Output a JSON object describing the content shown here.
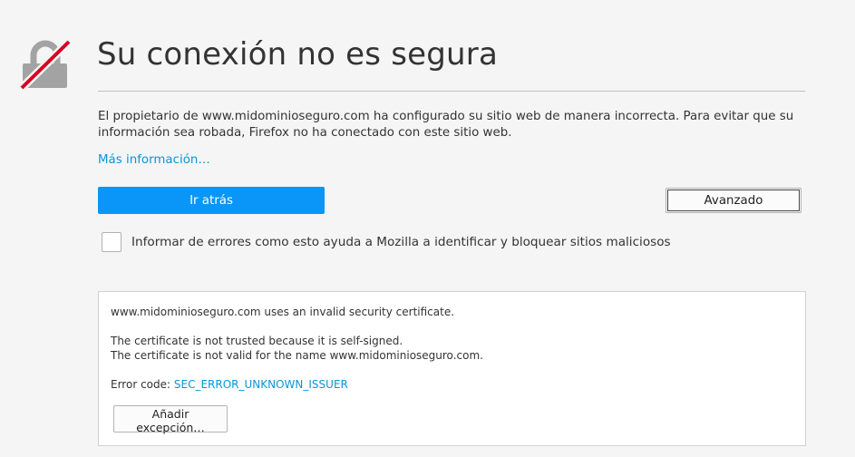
{
  "page": {
    "title": "Su conexión no es segura",
    "description": "El propietario de www.midominioseguro.com ha configurado su sitio web de manera incorrecta. Para evitar que su información sea robada, Firefox no ha conectado con este sitio web.",
    "more_info_link": "Más información…",
    "back_button": "Ir atrás",
    "advanced_button": "Avanzado",
    "report_checkbox_label": "Informar de errores como esto ayuda a Mozilla a identificar y bloquear sitios maliciosos"
  },
  "advanced_panel": {
    "invalid_cert_text": "www.midominioseguro.com uses an invalid security certificate.",
    "not_trusted_text": "The certificate is not trusted because it is self-signed.",
    "not_valid_name_text": "The certificate is not valid for the name www.midominioseguro.com.",
    "error_code_label": "Error code:",
    "error_code": "SEC_ERROR_UNKNOWN_ISSUER",
    "add_exception_button": "Añadir excepción…"
  },
  "icons": {
    "lock": "broken-lock-icon"
  },
  "colors": {
    "accent_blue": "#0996f8",
    "link_blue": "#0996d6",
    "strike_red": "#d70022",
    "lock_gray": "#a3a3a3"
  }
}
